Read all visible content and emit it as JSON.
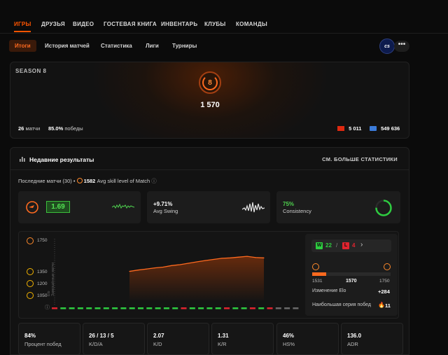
{
  "nav": {
    "tabs": [
      "ИГРЫ",
      "ДРУЗЬЯ",
      "ВИДЕО",
      "ГОСТЕВАЯ КНИГА",
      "ИНВЕНТАРЬ",
      "КЛУБЫ",
      "КОМАНДЫ"
    ],
    "active": "ИГРЫ"
  },
  "subnav": {
    "tabs": [
      "Итоги",
      "История матчей",
      "Статистика",
      "Лиги",
      "Турниры"
    ],
    "active": "Итоги",
    "game_logo": "cs",
    "more": "•••"
  },
  "season": {
    "label": "SEASON 8",
    "level": "8",
    "elo": "1 570",
    "matches_value": "26",
    "matches_label": "матчи",
    "wins_value": "85.0%",
    "wins_label": "победы",
    "country_rank": "5 011",
    "global_rank": "549 636"
  },
  "recent": {
    "title": "Недавние результаты",
    "see_more": "СМ. БОЛЬШЕ СТАТИСТИКИ",
    "last_matches": "Последние матчи (30) •",
    "avg_skill_value": "1582",
    "avg_skill_label": "Avg skill level of Match",
    "info_icon": "ⓘ"
  },
  "cards": {
    "rating_value": "1.69",
    "swing_value": "+9.71%",
    "swing_label": "Avg Swing",
    "consistency_value": "75%",
    "consistency_label": "Consistency"
  },
  "chart": {
    "y_ticks": [
      "1750",
      "1350",
      "1200",
      "1050"
    ],
    "y_axis_caption": "Elo\nЗавершённые матчи"
  },
  "chart_data": {
    "type": "area",
    "ylim": [
      1000,
      1800
    ],
    "values": [
      1395,
      1412,
      1425,
      1440,
      1450,
      1470,
      1482,
      1500,
      1518,
      1535,
      1550,
      1565,
      1570,
      1580,
      1590,
      1575,
      1570
    ],
    "results": [
      "L",
      "W",
      "W",
      "W",
      "W",
      "W",
      "W",
      "W",
      "W",
      "W",
      "W",
      "W",
      "W",
      "W",
      "W",
      "L",
      "W",
      "W",
      "W",
      "W",
      "L",
      "W",
      "W",
      "L",
      "W",
      "L",
      "N",
      "N",
      "N"
    ]
  },
  "side": {
    "wins": "22",
    "losses": "4",
    "w_label": "W",
    "l_label": "L",
    "separator": "/",
    "chevron": "›",
    "range_min": "1531",
    "range_current": "1570",
    "range_max": "1750",
    "elo_change_label": "Изменение Elo",
    "elo_change_value": "+284",
    "streak_label": "Наибольшая серия побед",
    "streak_value": "11",
    "progress_fraction": 0.18
  },
  "stats": [
    {
      "value": "84%",
      "label": "Процент побед"
    },
    {
      "value": "26 / 13 / 5",
      "label": "K/D/A"
    },
    {
      "value": "2.07",
      "label": "K/D"
    },
    {
      "value": "1.31",
      "label": "K/R"
    },
    {
      "value": "46%",
      "label": "HS%"
    },
    {
      "value": "136.0",
      "label": "ADR"
    }
  ],
  "colors": {
    "accent": "#ff5500",
    "win": "#2ecc40",
    "loss": "#e0242f",
    "neutral": "#6a6a6a",
    "consistency": "#2ecc40"
  }
}
